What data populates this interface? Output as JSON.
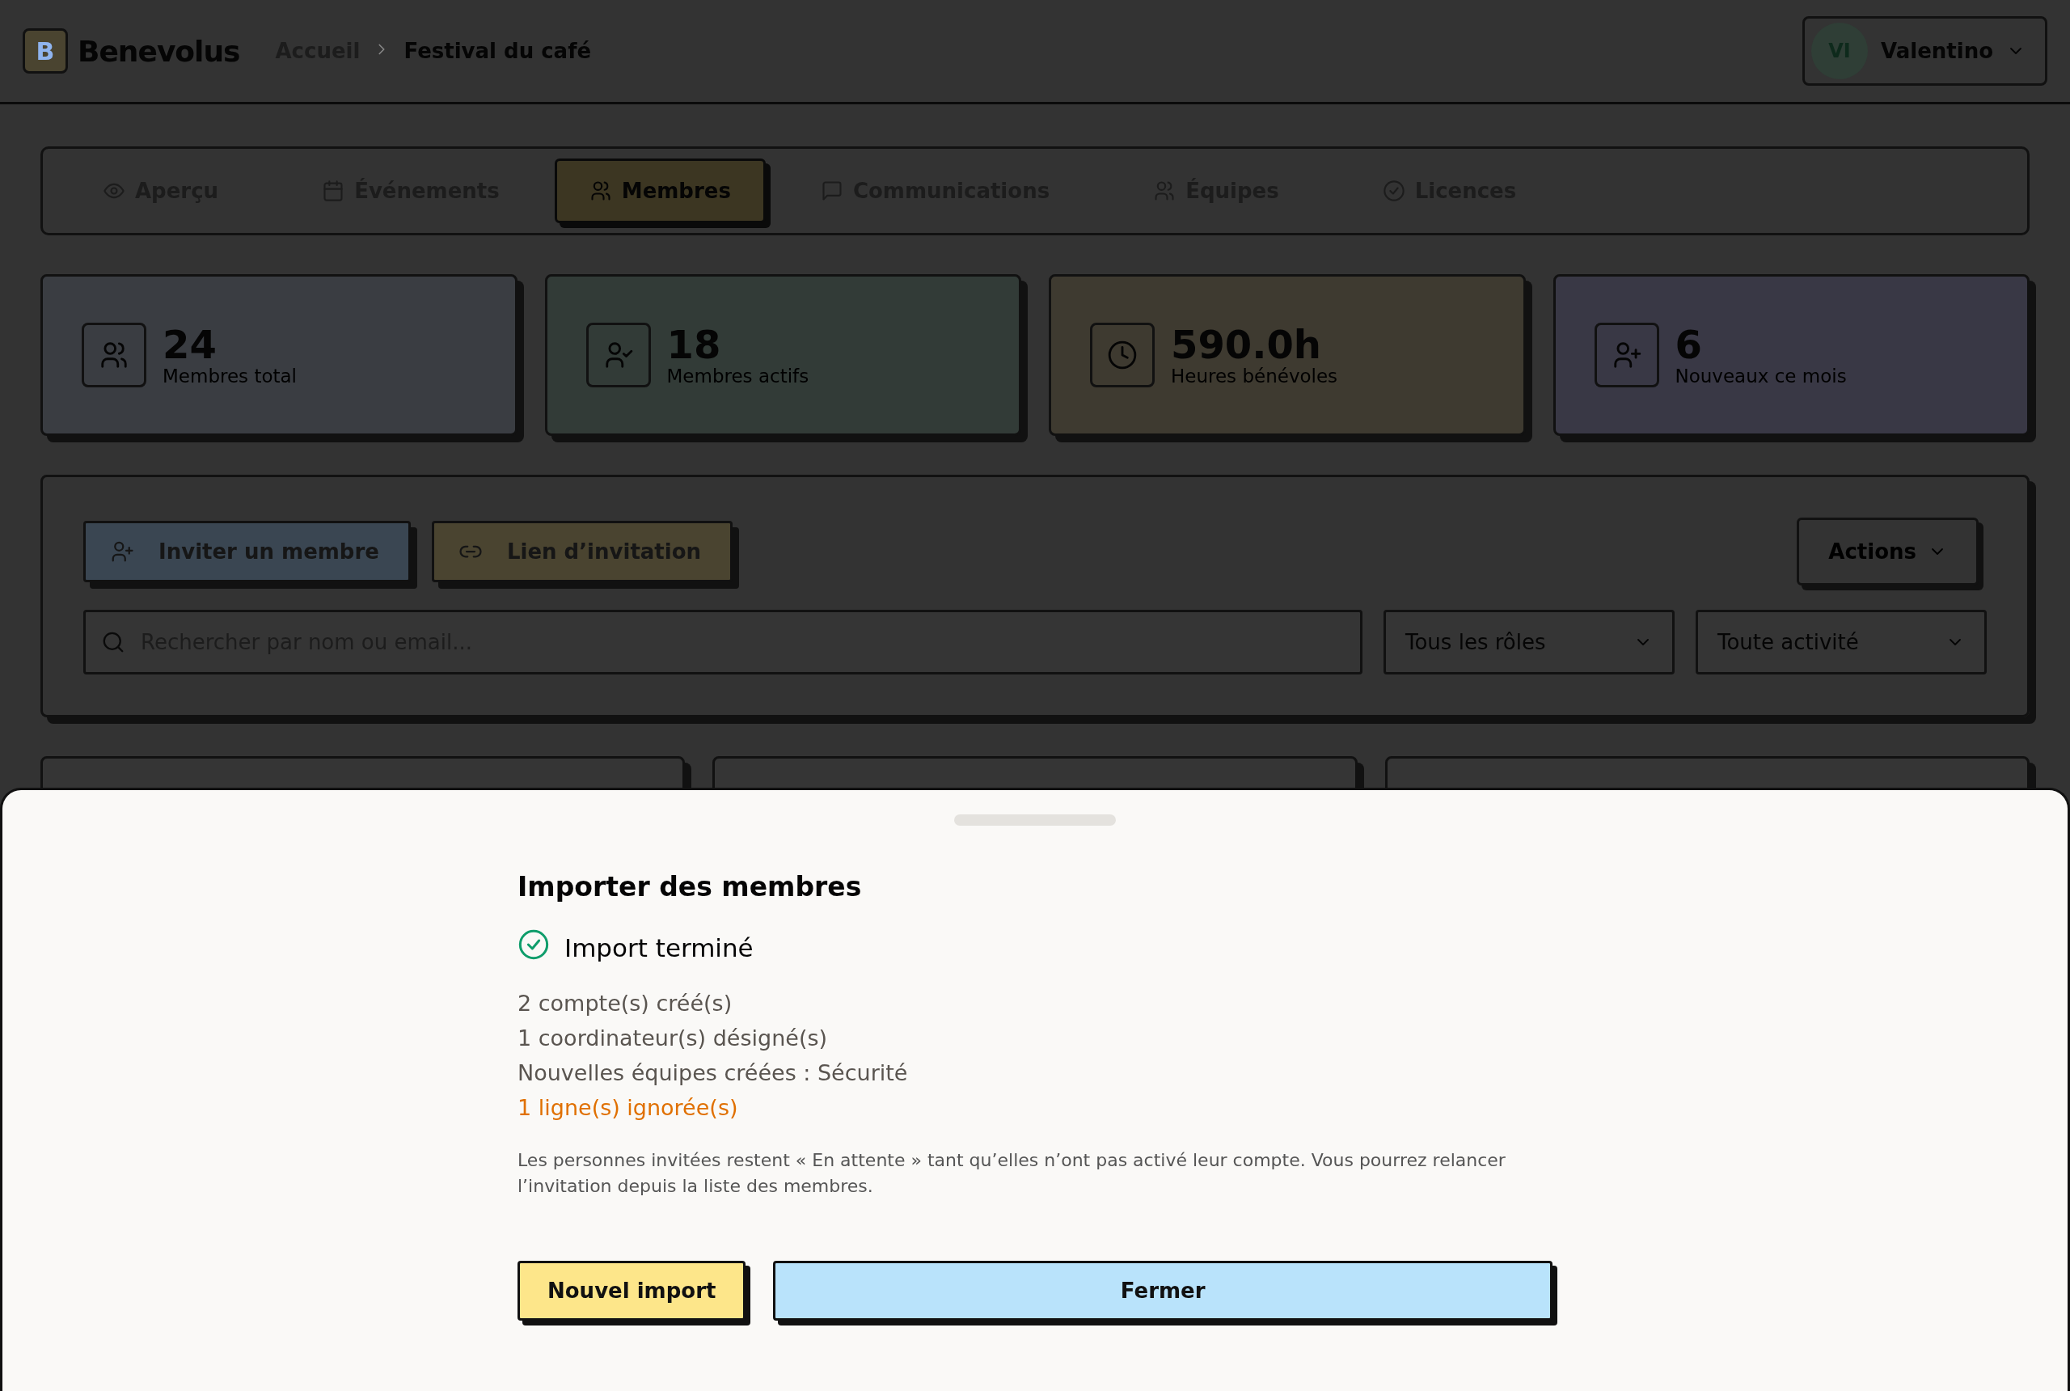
{
  "header": {
    "logo_letter": "B",
    "brand": "Benevolus",
    "breadcrumb": [
      {
        "label": "Accueil",
        "current": false
      },
      {
        "label": "Festival du café",
        "current": true
      }
    ],
    "user": {
      "initials": "VI",
      "name": "Valentino"
    }
  },
  "tabs": [
    {
      "label": "Aperçu",
      "selected": false
    },
    {
      "label": "Événements",
      "selected": false
    },
    {
      "label": "Membres",
      "selected": true
    },
    {
      "label": "Communications",
      "selected": false
    },
    {
      "label": "Équipes",
      "selected": false
    },
    {
      "label": "Licences",
      "selected": false
    }
  ],
  "stats": [
    {
      "value": "24",
      "label": "Membres total",
      "color": "#3a3d42"
    },
    {
      "value": "18",
      "label": "Membres actifs",
      "color": "#323b37"
    },
    {
      "value": "590.0h",
      "label": "Heures bénévoles",
      "color": "#3e3a30"
    },
    {
      "value": "6",
      "label": "Nouveaux ce mois",
      "color": "#393845"
    }
  ],
  "toolbar": {
    "buttons": [
      {
        "label": "Inviter un membre",
        "color": "#3a4652"
      },
      {
        "label": "Lien d’invitation",
        "color": "#4a4430"
      }
    ],
    "actions": "Actions",
    "search": {
      "placeholder": "Rechercher par nom ou email..."
    },
    "filters": [
      "Tous les rôles",
      "Toute activité"
    ]
  },
  "sheet": {
    "title": "Importer des membres",
    "status": "Import terminé",
    "results": [
      {
        "text": "2 compte(s) créé(s)",
        "kind": "info"
      },
      {
        "text": "1 coordinateur(s) désigné(s)",
        "kind": "info"
      },
      {
        "text": "Nouvelles équipes créées : Sécurité",
        "kind": "info"
      },
      {
        "text": "1 ligne(s) ignorée(s)",
        "kind": "warning"
      }
    ],
    "note": "Les personnes invitées restent « En attente » tant qu’elles n’ont pas activé leur compte. Vous pourrez relancer l’invitation depuis la liste des membres.",
    "buttons": [
      {
        "label": "Nouvel import",
        "color": "#fde68a"
      },
      {
        "label": "Fermer",
        "color": "#b9e3fb"
      }
    ]
  }
}
